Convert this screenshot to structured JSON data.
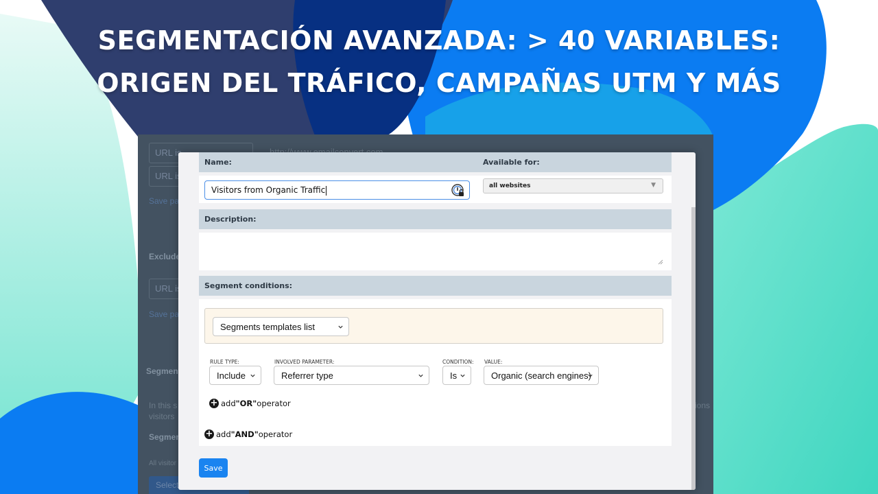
{
  "headline": {
    "line1": "SEGMENTACIÓN AVANZADA: > 40 VARIABLES:",
    "line2": "ORIGEN DEL TRÁFICO, CAMPAÑAS UTM Y MÁS"
  },
  "background_app": {
    "url_rows": [
      "URL is",
      "URL is"
    ],
    "url_value": "http://www.emailconvert.com",
    "save_link": "Save pa",
    "exclude_label": "Exclude",
    "url_row_3": "URL is",
    "save_link_2": "Save pa",
    "segment_label": "Segment",
    "intro_text": "In this s",
    "intro_text_2": "visitors",
    "intro_tail": "ions",
    "segment_label_2": "Segmen",
    "all_visitors": "All visitor",
    "select_button": "Select"
  },
  "modal": {
    "name_header": "Name:",
    "available_header": "Available for:",
    "name_value": "Visitors from Organic Traffic",
    "available_value": "all websites",
    "description_header": "Description:",
    "description_value": "",
    "conditions_header": "Segment conditions:",
    "templates_select": "Segments templates list",
    "rule": {
      "rule_type_label": "RULE TYPE:",
      "rule_type_value": "Include",
      "parameter_label": "INVOLVED PARAMETER:",
      "parameter_value": "Referrer type",
      "condition_label": "CONDITION:",
      "condition_value": "Is",
      "value_label": "VALUE:",
      "value_value": "Organic (search engines)"
    },
    "or_operator": {
      "prefix": "add ",
      "keyword": "\"OR\"",
      "suffix": " operator"
    },
    "and_operator": {
      "prefix": "add ",
      "keyword": "\"AND\"",
      "suffix": " operator"
    },
    "save_label": "Save"
  },
  "icons": {
    "lock": "lock-icon",
    "caret": "caret-down-icon",
    "plus": "plus-circle-icon",
    "resize": "resize-handle-icon"
  },
  "colors": {
    "accent": "#1a84f0",
    "section_header": "#c9d5de",
    "templates_bg": "#fdf6ea",
    "dark_navy": "#2b3a6b",
    "bright_blue": "#0a7af0",
    "teal": "#5ee0c8"
  }
}
